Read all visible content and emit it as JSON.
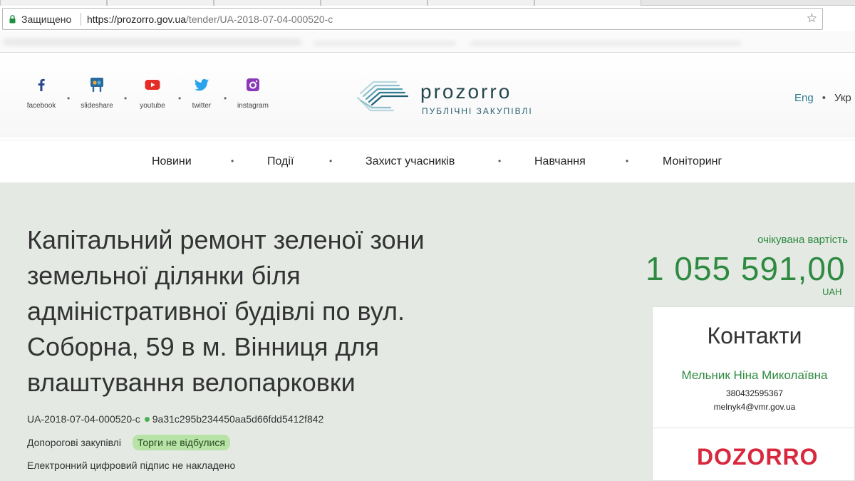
{
  "browser": {
    "secure_label": "Защищено",
    "url_host": "https://prozorro.gov.ua",
    "url_path": "/tender/UA-2018-07-04-000520-c"
  },
  "header": {
    "social": [
      {
        "label": "facebook",
        "icon": "facebook-icon"
      },
      {
        "label": "slideshare",
        "icon": "slideshare-icon"
      },
      {
        "label": "youtube",
        "icon": "youtube-icon"
      },
      {
        "label": "twitter",
        "icon": "twitter-icon"
      },
      {
        "label": "instagram",
        "icon": "instagram-icon"
      }
    ],
    "logo_word": "prozorro",
    "logo_sub": "ПУБЛІЧНІ ЗАКУПІВЛІ",
    "lang_en": "Eng",
    "lang_ua": "Укр"
  },
  "nav": {
    "items": [
      "Новини",
      "Події",
      "Захист учасників",
      "Навчання",
      "Моніторинг"
    ]
  },
  "tender": {
    "title": "Капітальний ремонт зеленої зони земельної ділянки біля адміністративної будівлі по вул. Соборна, 59 в м. Вінниця для влаштування велопарковки",
    "id": "UA-2018-07-04-000520-c",
    "hash": "9a31c295b234450aa5d66fdd5412f842",
    "procedure": "Допорогові закупівлі",
    "status": "Торги не відбулися",
    "signature": "Електронний цифровий підпис не накладено",
    "expected_label": "очікувана вартість",
    "expected_amount": "1 055 591,00",
    "currency": "UAH"
  },
  "contacts": {
    "title": "Контакти",
    "name": "Мельник Ніна Миколаївна",
    "phone": "380432595367",
    "email": "melnyk4@vmr.gov.ua",
    "partner": "DOZORRO"
  },
  "colors": {
    "accent_green": "#2f8a41",
    "badge_green": "#b7e3a6",
    "content_bg": "#e4e9e4",
    "dozorro_red": "#d7283d"
  }
}
